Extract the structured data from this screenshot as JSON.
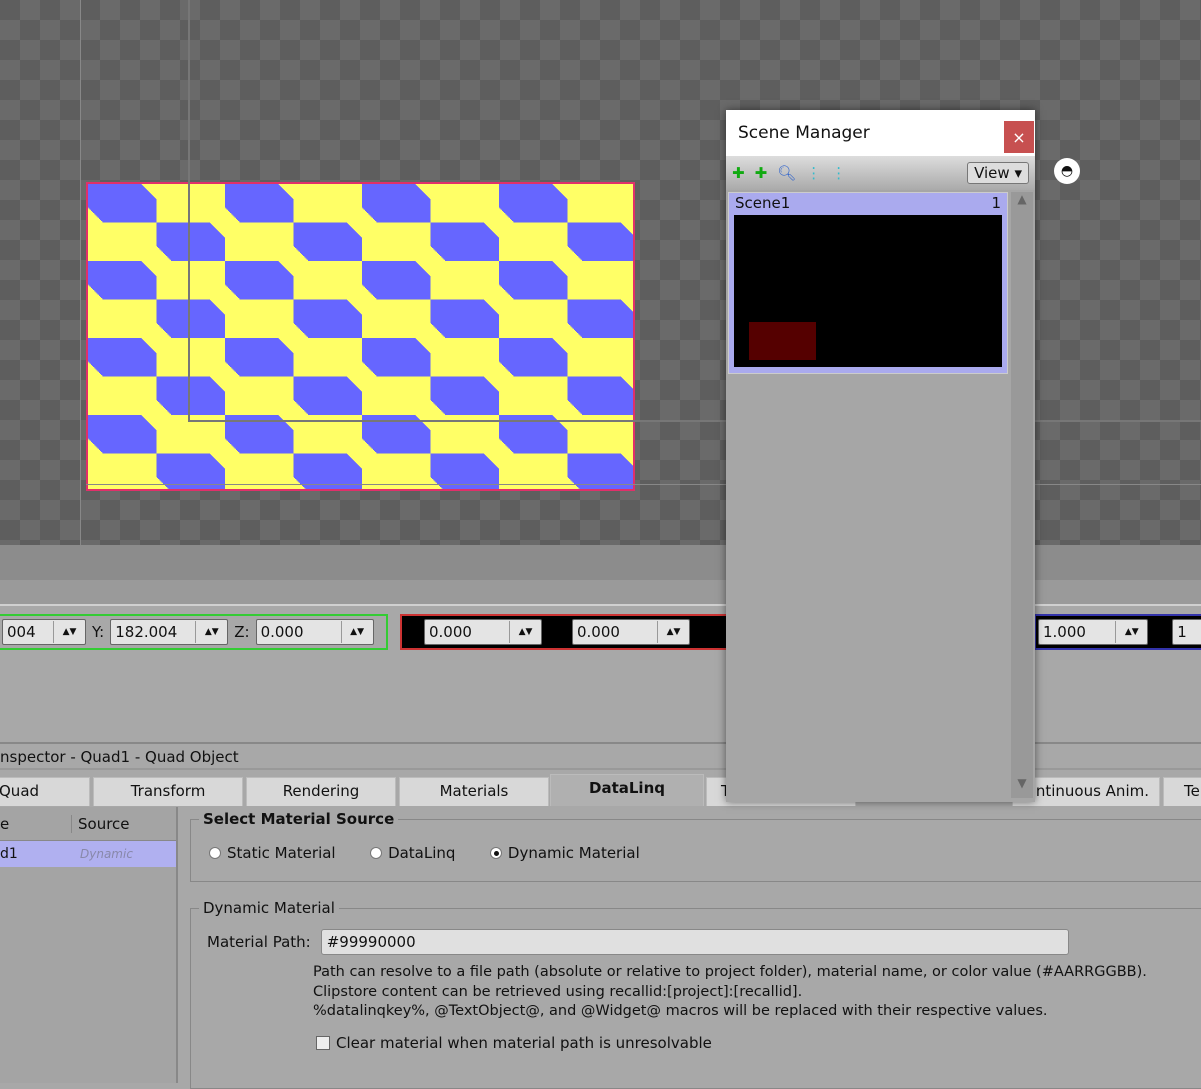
{
  "transform_bar": {
    "x_value": "004",
    "y_label": "Y:",
    "y_value": "182.004",
    "z_label": "Z:",
    "z_value": "0.000",
    "rot1": "0.000",
    "rot2": "0.000",
    "scale1": "1.000",
    "scale2": "1"
  },
  "inspector": {
    "title": "nspector - Quad1 - Quad Object",
    "tabs": [
      "Quad",
      "Transform",
      "Rendering",
      "Materials",
      "DataLinq",
      "T",
      "ontinuous Anim.",
      "Te"
    ],
    "list": {
      "col1": "e",
      "col2": "Source",
      "row_name": "d1",
      "row_source": "Dynamic"
    },
    "select_source": {
      "legend": "Select Material Source",
      "options": [
        "Static Material",
        "DataLinq",
        "Dynamic Material"
      ],
      "selected": "Dynamic Material"
    },
    "dynamic": {
      "legend": "Dynamic Material",
      "path_label": "Material Path:",
      "path_value": "#99990000",
      "help": [
        "Path can resolve to a file path (absolute or relative to project folder), material name, or color value (#AARRGGBB).",
        "Clipstore content can be retrieved using recallid:[project]:[recallid].",
        "%datalinqkey%, @TextObject@, and @Widget@ macros will be replaced with their respective values."
      ],
      "clear_label": "Clear material when material path is unresolvable",
      "clear_checked": false
    }
  },
  "scene_manager": {
    "title": "Scene Manager",
    "close": "×",
    "view_label": "View",
    "scene_name": "Scene1",
    "scene_index": "1"
  }
}
